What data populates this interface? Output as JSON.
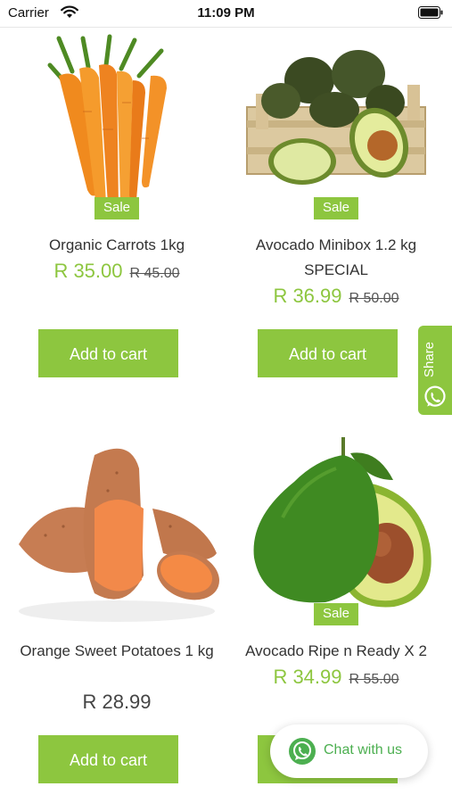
{
  "status_bar": {
    "carrier": "Carrier",
    "time": "11:09 PM"
  },
  "products": [
    {
      "name": "Organic Carrots 1kg",
      "badge": "Sale",
      "price": "R 35.00",
      "old_price": "R 45.00",
      "button": "Add to cart",
      "image": "carrots"
    },
    {
      "name": "Avocado Minibox 1.2 kg SPECIAL",
      "badge": "Sale",
      "price": "R 36.99",
      "old_price": "R 50.00",
      "button": "Add to cart",
      "image": "avocado-box"
    },
    {
      "name": "Orange Sweet Potatoes 1 kg",
      "price": "R 28.99",
      "button": "Add to cart",
      "image": "sweet-potatoes"
    },
    {
      "name": "Avocado Ripe n Ready X 2",
      "badge": "Sale",
      "price": "R 34.99",
      "old_price": "R 55.00",
      "button": "Add to cart",
      "image": "avocado-halves"
    }
  ],
  "share_tab": {
    "label": "Share",
    "icon": "whatsapp-icon"
  },
  "chat_widget": {
    "label": "Chat with us",
    "icon": "whatsapp-icon"
  },
  "colors": {
    "accent": "#8dc63f",
    "whatsapp": "#4caf50"
  }
}
